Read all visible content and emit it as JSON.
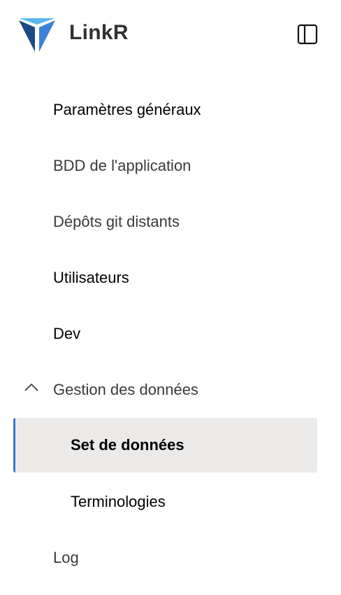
{
  "app": {
    "title": "LinkR"
  },
  "nav": {
    "items": [
      {
        "label": "Paramètres généraux"
      },
      {
        "label": "BDD de l'application"
      },
      {
        "label": "Dépôts git distants"
      },
      {
        "label": "Utilisateurs"
      },
      {
        "label": "Dev"
      },
      {
        "label": "Gestion des données"
      },
      {
        "label": "Set de données"
      },
      {
        "label": "Terminologies"
      },
      {
        "label": "Log"
      }
    ]
  },
  "colors": {
    "accent": "#3a78d0",
    "selected_bg": "#ebeae9"
  }
}
